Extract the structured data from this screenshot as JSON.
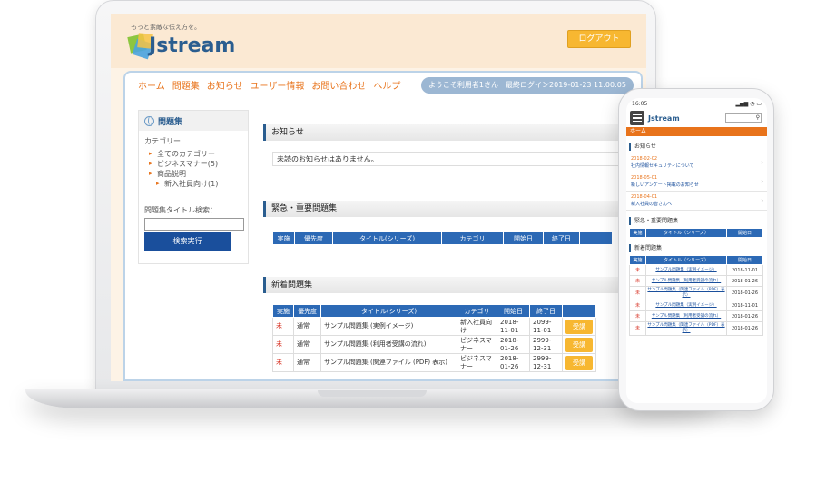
{
  "desktop": {
    "tagline": "もっと素敵な伝え方を。",
    "logo_text": "stream",
    "logo_letter": "J",
    "logout_label": "ログアウト",
    "nav": [
      "ホーム",
      "問題集",
      "お知らせ",
      "ユーザー情報",
      "お問い合わせ",
      "ヘルプ"
    ],
    "welcome": "ようこそ利用者1さん　最終ログイン2019-01-23 11:00:05",
    "sidebar": {
      "title": "問題集",
      "category_label": "カテゴリー",
      "categories": [
        "全てのカテゴリー",
        "ビジネスマナー(5)",
        "商品説明"
      ],
      "sub_category": "新入社員向け(1)",
      "search_label": "問題集タイトル検索：",
      "search_value": "",
      "search_button": "検索実行"
    },
    "notices": {
      "title": "お知らせ",
      "empty_message": "未読のお知らせはありません。"
    },
    "urgent": {
      "title": "緊急・重要問題集",
      "headers": [
        "実施",
        "優先度",
        "タイトル(シリーズ)",
        "カテゴリ",
        "開始日",
        "終了日"
      ]
    },
    "new": {
      "title": "新着問題集",
      "headers": [
        "実施",
        "優先度",
        "タイトル(シリーズ)",
        "カテゴリ",
        "開始日",
        "終了日",
        ""
      ],
      "rows": [
        {
          "status": "未",
          "priority": "通常",
          "title": "サンプル問題集 (実例イメージ)",
          "category": "新入社員向け",
          "start": "2018-11-01",
          "end": "2099-11-01",
          "action": "受講"
        },
        {
          "status": "未",
          "priority": "通常",
          "title": "サンプル問題集 (利用者受講の流れ)",
          "category": "ビジネスマナー",
          "start": "2018-01-26",
          "end": "2999-12-31",
          "action": "受講"
        },
        {
          "status": "未",
          "priority": "通常",
          "title": "サンプル問題集 (関連ファイル (PDF) 表示)",
          "category": "ビジネスマナー",
          "start": "2018-01-26",
          "end": "2999-12-31",
          "action": "受講"
        }
      ]
    }
  },
  "phone": {
    "time": "16:05",
    "logo_text": "Jstream",
    "home_label": "ホーム",
    "notices_title": "お知らせ",
    "news": [
      {
        "date": "2018-02-02",
        "title": "社内情報セキュリティについて"
      },
      {
        "date": "2018-05-01",
        "title": "新しいアンケート掲載のお知らせ"
      },
      {
        "date": "2018-04-01",
        "title": "新入社員の皆さんへ"
      }
    ],
    "urgent_title": "緊急・重要問題集",
    "urgent_headers": [
      "実施",
      "タイトル（シリーズ）",
      "開始日"
    ],
    "new_title": "新着問題集",
    "new_headers": [
      "実施",
      "タイトル（シリーズ）",
      "開始日"
    ],
    "new_rows": [
      {
        "status": "未",
        "title": "サンプル問題集（実例イメージ）",
        "start": "2018-11-01"
      },
      {
        "status": "未",
        "title": "サンプル問題集（利用者受講の流れ）",
        "start": "2018-01-26"
      },
      {
        "status": "未",
        "title": "サンプル問題集（関連ファイル（PDF）表示）",
        "start": "2018-01-26"
      },
      {
        "status": "未",
        "title": "サンプル問題集（実例イメージ）",
        "start": "2018-11-01"
      },
      {
        "status": "未",
        "title": "サンプル問題集（利用者受講の流れ）",
        "start": "2018-01-26"
      },
      {
        "status": "未",
        "title": "サンプル問題集（関連ファイル（PDF）表示）",
        "start": "2018-01-26"
      }
    ]
  }
}
